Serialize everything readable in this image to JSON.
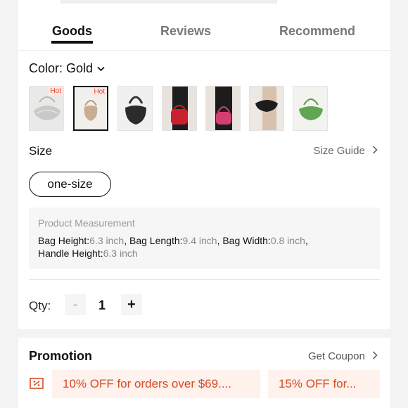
{
  "tabs": [
    {
      "label": "Goods",
      "active": true
    },
    {
      "label": "Reviews",
      "active": false
    },
    {
      "label": "Recommend",
      "active": false
    }
  ],
  "color": {
    "label": "Color: Gold",
    "chevron_icon": "chevron-down-icon"
  },
  "swatches": [
    {
      "name": "silver",
      "badge": "Hot",
      "selected": false
    },
    {
      "name": "gold",
      "badge": "Hot",
      "selected": true
    },
    {
      "name": "black",
      "badge": "",
      "selected": false
    },
    {
      "name": "red",
      "badge": "",
      "selected": false
    },
    {
      "name": "pink",
      "badge": "",
      "selected": false
    },
    {
      "name": "black-model",
      "badge": "",
      "selected": false
    },
    {
      "name": "green",
      "badge": "",
      "selected": false
    }
  ],
  "size": {
    "label": "Size",
    "guide": "Size Guide",
    "selected": "one-size"
  },
  "measurement": {
    "title": "Product Measurement",
    "bag_height_label": "Bag Height:",
    "bag_height": "6.3 inch",
    "bag_length_label": "Bag Length:",
    "bag_length": "9.4 inch",
    "bag_width_label": "Bag Width:",
    "bag_width": "0.8 inch",
    "handle_height_label": "Handle Height:",
    "handle_height": "6.3 inch"
  },
  "qty": {
    "label": "Qty:",
    "minus": "-",
    "value": "1",
    "plus": "+"
  },
  "promotion": {
    "title": "Promotion",
    "coupon": "Get Coupon",
    "offers": [
      "10% OFF for orders over $69....",
      "15% OFF for..."
    ]
  },
  "colors": {
    "accent": "#e6452f",
    "promo_bg": "#fff1ec",
    "promo_text": "#d64a24"
  }
}
